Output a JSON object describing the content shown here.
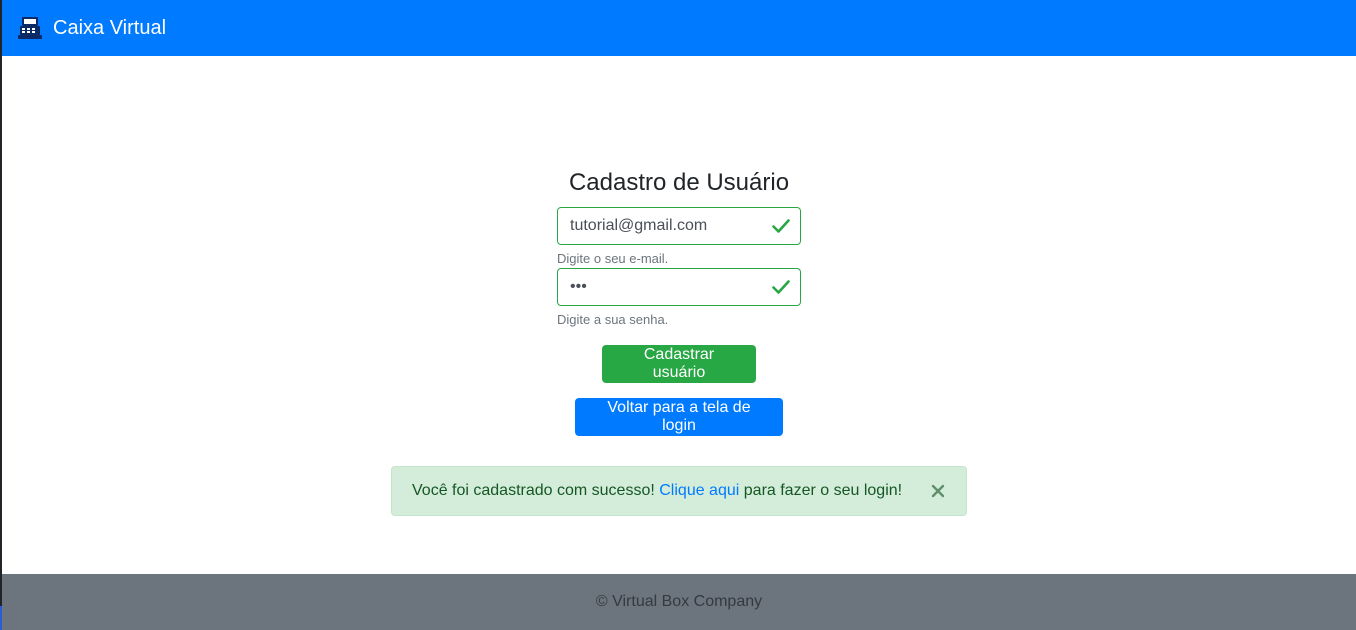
{
  "navbar": {
    "brand_icon": "cash-register-icon",
    "brand_text": "Caixa Virtual"
  },
  "form": {
    "title": "Cadastro de Usuário",
    "email": {
      "value": "tutorial@gmail.com",
      "help": "Digite o seu e-mail.",
      "valid_icon": "check-icon"
    },
    "password": {
      "value": "abc",
      "help": "Digite a sua senha.",
      "valid_icon": "check-icon"
    },
    "register_button": "Cadastrar usuário",
    "back_button": "Voltar para a tela de login"
  },
  "alert": {
    "text_before": "Você foi cadastrado com sucesso!",
    "link_text": "Clique aqui",
    "text_after": "para fazer o seu login!",
    "close_icon": "close-icon"
  },
  "footer": {
    "text": "© Virtual Box Company"
  },
  "colors": {
    "primary": "#007bff",
    "success": "#28a745",
    "alert_bg": "#d4edda",
    "footer_bg": "#6c757d"
  }
}
